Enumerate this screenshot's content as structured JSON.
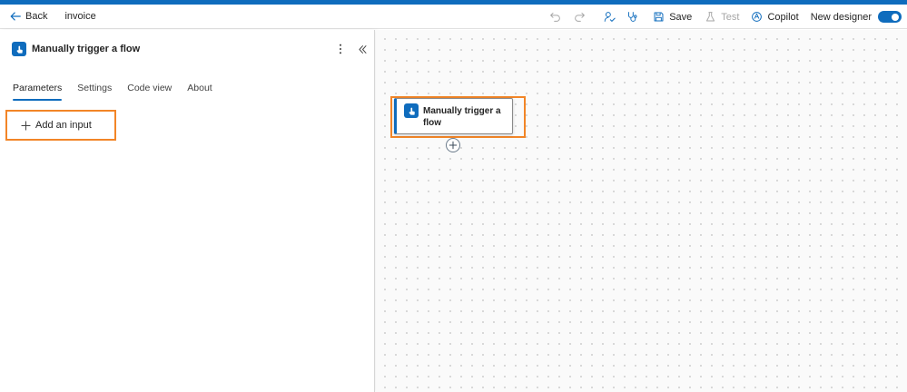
{
  "colors": {
    "accent": "#0f6cbd",
    "highlight": "#f28527"
  },
  "toolbar": {
    "back_label": "Back",
    "flow_name": "invoice",
    "save_label": "Save",
    "test_label": "Test",
    "copilot_label": "Copilot",
    "new_designer_label": "New designer",
    "new_designer_enabled": true
  },
  "panel": {
    "title": "Manually trigger a flow",
    "tabs": [
      {
        "label": "Parameters",
        "active": true
      },
      {
        "label": "Settings",
        "active": false
      },
      {
        "label": "Code view",
        "active": false
      },
      {
        "label": "About",
        "active": false
      }
    ],
    "add_input_label": "Add an input"
  },
  "canvas": {
    "node_label": "Manually trigger a flow"
  },
  "icons": [
    "back-arrow-icon",
    "undo-icon",
    "redo-icon",
    "flow-checker-icon",
    "stethoscope-icon",
    "save-icon",
    "flask-icon",
    "copilot-icon",
    "touch-icon",
    "more-icon",
    "double-chevron-left-icon",
    "plus-icon",
    "add-step-icon"
  ]
}
